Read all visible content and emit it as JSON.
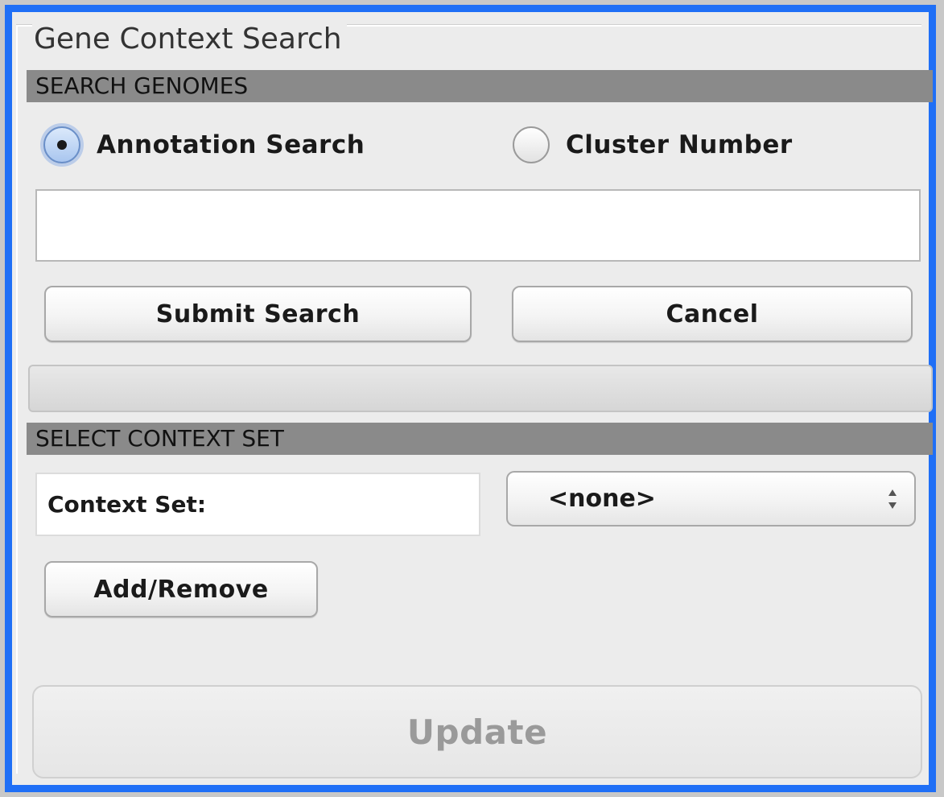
{
  "panel": {
    "title": "Gene Context Search"
  },
  "search_genomes": {
    "header": "SEARCH GENOMES",
    "radio_options": [
      {
        "label": "Annotation Search",
        "selected": true
      },
      {
        "label": "Cluster Number",
        "selected": false
      }
    ],
    "query_value": "",
    "submit_label": "Submit Search",
    "cancel_label": "Cancel",
    "progress": 0
  },
  "context_set": {
    "header": "SELECT CONTEXT SET",
    "label": "Context Set:",
    "selected_value": "<none>",
    "add_remove_label": "Add/Remove"
  },
  "update_label": "Update",
  "colors": {
    "focus_ring": "#1f6ff6",
    "section_header_bg": "#8a8a8a",
    "disabled_text": "#9a9a9a"
  },
  "icons": {
    "select_arrows": "up-down-chevron-icon",
    "radio_selected": "radio-dot-icon"
  }
}
